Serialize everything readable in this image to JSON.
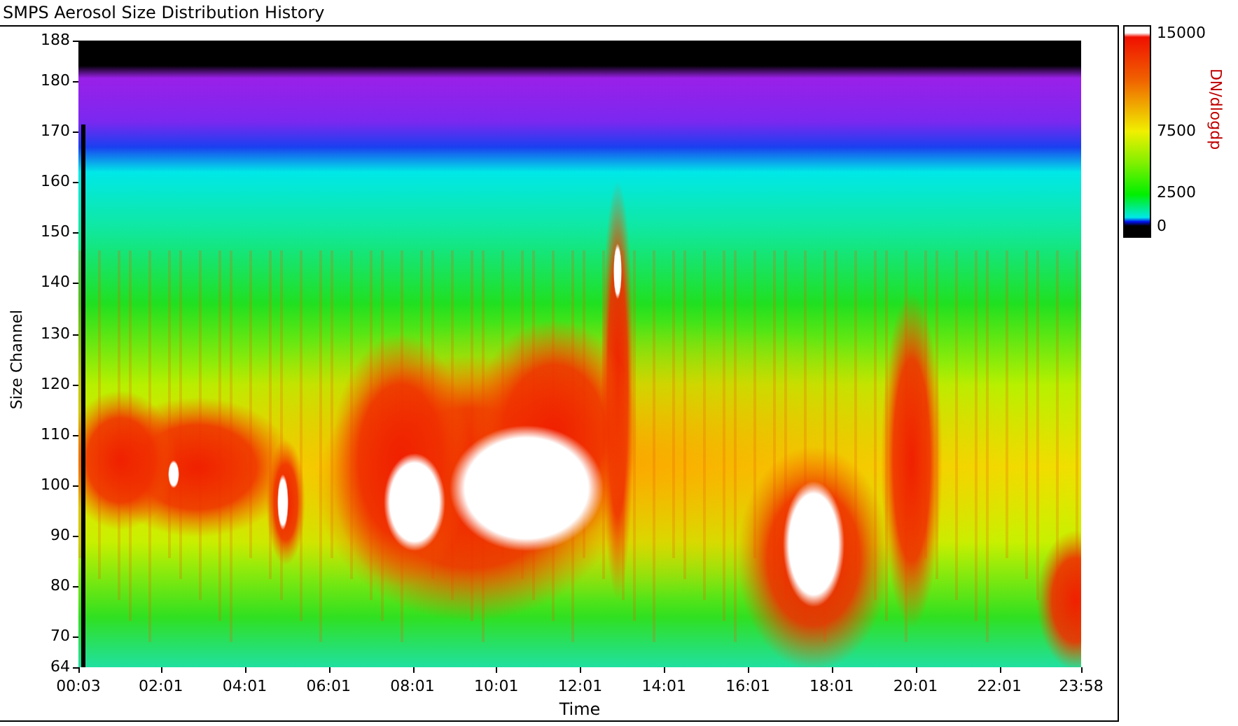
{
  "title": "SMPS Aerosol Size Distribution History",
  "plot": {
    "ylabel": "Size Channel",
    "xlabel": "Time",
    "yticks": [
      "188",
      "180",
      "170",
      "160",
      "150",
      "140",
      "130",
      "120",
      "110",
      "100",
      "90",
      "80",
      "70",
      "64"
    ],
    "xticks": [
      "00:03",
      "02:01",
      "04:01",
      "06:01",
      "08:01",
      "10:01",
      "12:01",
      "14:01",
      "16:01",
      "18:01",
      "20:01",
      "22:01",
      "23:58"
    ]
  },
  "colorbar": {
    "label": "DN/dlogdp",
    "ticks": [
      "15000",
      "7500",
      "2500",
      "0"
    ]
  }
}
